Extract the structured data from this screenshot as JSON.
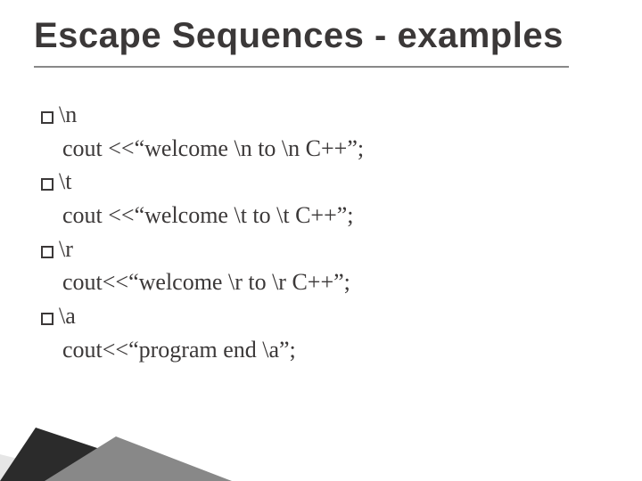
{
  "title": "Escape Sequences - examples",
  "items": [
    {
      "bullet_label": "\\n",
      "code": "cout <<“welcome \\n to \\n C++”;"
    },
    {
      "bullet_label": "\\t",
      "code": "cout <<“welcome \\t to \\t C++”;"
    },
    {
      "bullet_label": "\\r",
      "code": "cout<<“welcome \\r to \\r C++”;"
    },
    {
      "bullet_label": "\\a",
      "code": "cout<<“program end \\a”;"
    }
  ]
}
